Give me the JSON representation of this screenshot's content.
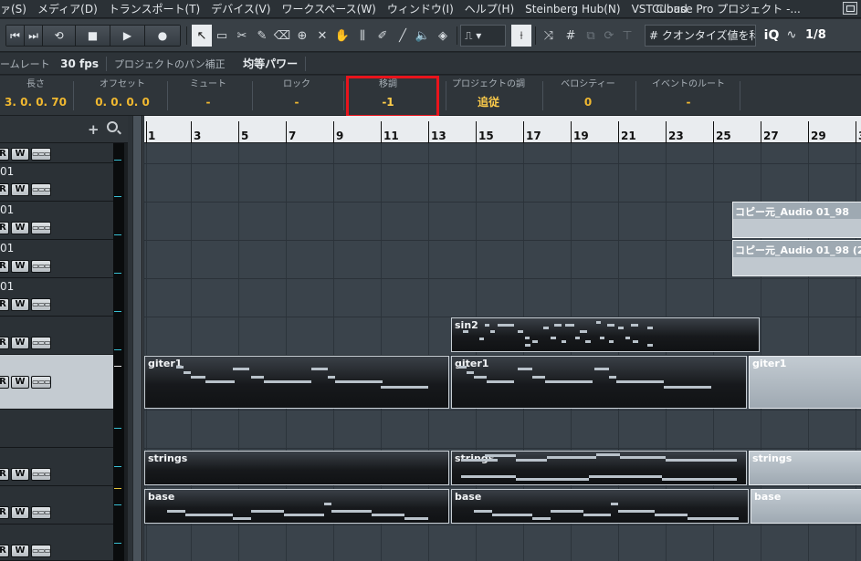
{
  "menu": {
    "items": [
      "ァ(S)",
      "メディア(D)",
      "トランスポート(T)",
      "デバイス(V)",
      "ワークスペース(W)",
      "ウィンドウ(I)",
      "ヘルプ(H)",
      "Steinberg Hub(N)",
      "VST Cloud"
    ],
    "app_title": "Cubase Pro プロジェクト -..."
  },
  "toolbar": {
    "quantize_label": "クオンタイズ値を科",
    "ratio": "1/8",
    "iq": "iQ"
  },
  "status": {
    "frame_rate_label": "ームレート",
    "frame_rate_value": "30 fps",
    "pan_label": "プロジェクトのパン補正",
    "pan_value": "均等パワー"
  },
  "info": {
    "length_label": "長さ",
    "length_value": "3. 0. 0. 70",
    "offset_label": "オフセット",
    "offset_value": "0. 0. 0. 0",
    "mute_label": "ミュート",
    "mute_value": "-",
    "lock_label": "ロック",
    "lock_value": "-",
    "transpose_label": "移調",
    "transpose_value": "-1",
    "key_label": "プロジェクトの調",
    "key_value": "追従",
    "velocity_label": "ベロシティー",
    "velocity_value": "0",
    "route_label": "イベントのルート",
    "route_value": "-"
  },
  "ruler": {
    "bars": [
      "1",
      "3",
      "5",
      "7",
      "9",
      "11",
      "13",
      "15",
      "17",
      "19",
      "21",
      "23",
      "25",
      "27",
      "29",
      "3"
    ]
  },
  "tracks": [
    {
      "name": ""
    },
    {
      "name": "01"
    },
    {
      "name": "01"
    },
    {
      "name": "01"
    },
    {
      "name": "01"
    },
    {
      "name": ""
    },
    {
      "name": ""
    },
    {
      "name": ""
    },
    {
      "name": ""
    },
    {
      "name": ""
    },
    {
      "name": ""
    }
  ],
  "track_buttons": {
    "r": "R",
    "w": "W",
    "e": "▭▭▭"
  },
  "parts": {
    "audio1": "コピー元_Audio 01_98",
    "audio2": "コピー元_Audio 01_98 (2",
    "sin2": "sin2",
    "giter_a": "giter1",
    "giter_b": "giter1",
    "giter_c": "giter1",
    "strings_a": "strings",
    "strings_b": "strings",
    "strings_c": "strings",
    "base_a": "base",
    "base_b": "base",
    "base_c": "base"
  }
}
